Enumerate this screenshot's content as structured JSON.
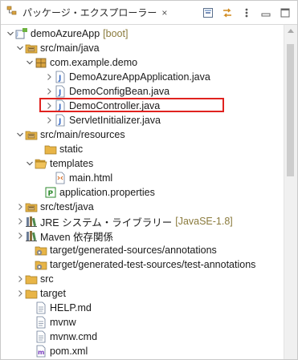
{
  "header": {
    "title": "パッケージ・エクスプローラー",
    "close_symbol": "×"
  },
  "toolbar": {
    "buttons": [
      "collapse-all",
      "link-with-editor",
      "view-menu",
      "minimize",
      "maximize"
    ]
  },
  "tree": {
    "rows": [
      {
        "label": "demoAzureApp",
        "decoration": "[boot]",
        "icon": "project-icon",
        "twisty": "expanded"
      },
      {
        "label": "src/main/java",
        "decoration": "",
        "icon": "source-folder-icon",
        "twisty": "expanded"
      },
      {
        "label": "com.example.demo",
        "decoration": "",
        "icon": "package-icon",
        "twisty": "expanded"
      },
      {
        "label": "DemoAzureAppApplication.java",
        "decoration": "",
        "icon": "java-file-icon",
        "twisty": "collapsed"
      },
      {
        "label": "DemoConfigBean.java",
        "decoration": "",
        "icon": "java-file-icon",
        "twisty": "collapsed"
      },
      {
        "label": "DemoController.java",
        "decoration": "",
        "icon": "java-file-icon",
        "twisty": "collapsed"
      },
      {
        "label": "ServletInitializer.java",
        "decoration": "",
        "icon": "java-file-icon",
        "twisty": "collapsed"
      },
      {
        "label": "src/main/resources",
        "decoration": "",
        "icon": "source-folder-icon",
        "twisty": "expanded"
      },
      {
        "label": "static",
        "decoration": "",
        "icon": "folder-icon",
        "twisty": "none"
      },
      {
        "label": "templates",
        "decoration": "",
        "icon": "folder-open-icon",
        "twisty": "expanded"
      },
      {
        "label": "main.html",
        "decoration": "",
        "icon": "html-file-icon",
        "twisty": "none"
      },
      {
        "label": "application.properties",
        "decoration": "",
        "icon": "properties-file-icon",
        "twisty": "none"
      },
      {
        "label": "src/test/java",
        "decoration": "",
        "icon": "source-folder-icon",
        "twisty": "collapsed"
      },
      {
        "label": "JRE システム・ライブラリー",
        "decoration": "[JavaSE-1.8]",
        "icon": "library-icon",
        "twisty": "collapsed"
      },
      {
        "label": "Maven 依存関係",
        "decoration": "",
        "icon": "library-icon",
        "twisty": "collapsed"
      },
      {
        "label": "target/generated-sources/annotations",
        "decoration": "",
        "icon": "source-folder-gear-icon",
        "twisty": "none"
      },
      {
        "label": "target/generated-test-sources/test-annotations",
        "decoration": "",
        "icon": "source-folder-gear-icon",
        "twisty": "none"
      },
      {
        "label": "src",
        "decoration": "",
        "icon": "folder-icon",
        "twisty": "collapsed"
      },
      {
        "label": "target",
        "decoration": "",
        "icon": "folder-icon",
        "twisty": "collapsed"
      },
      {
        "label": "HELP.md",
        "decoration": "",
        "icon": "text-file-icon",
        "twisty": "none"
      },
      {
        "label": "mvnw",
        "decoration": "",
        "icon": "text-file-icon",
        "twisty": "none"
      },
      {
        "label": "mvnw.cmd",
        "decoration": "",
        "icon": "text-file-icon",
        "twisty": "none"
      },
      {
        "label": "pom.xml",
        "decoration": "",
        "icon": "xml-file-icon",
        "twisty": "none"
      }
    ]
  },
  "highlighted_item": "DemoController.java",
  "colors": {
    "highlight_border": "#e0221f",
    "decoration_text": "#8a7a3c",
    "folder": "#e8b547",
    "java_icon": "#3b6ec7"
  }
}
